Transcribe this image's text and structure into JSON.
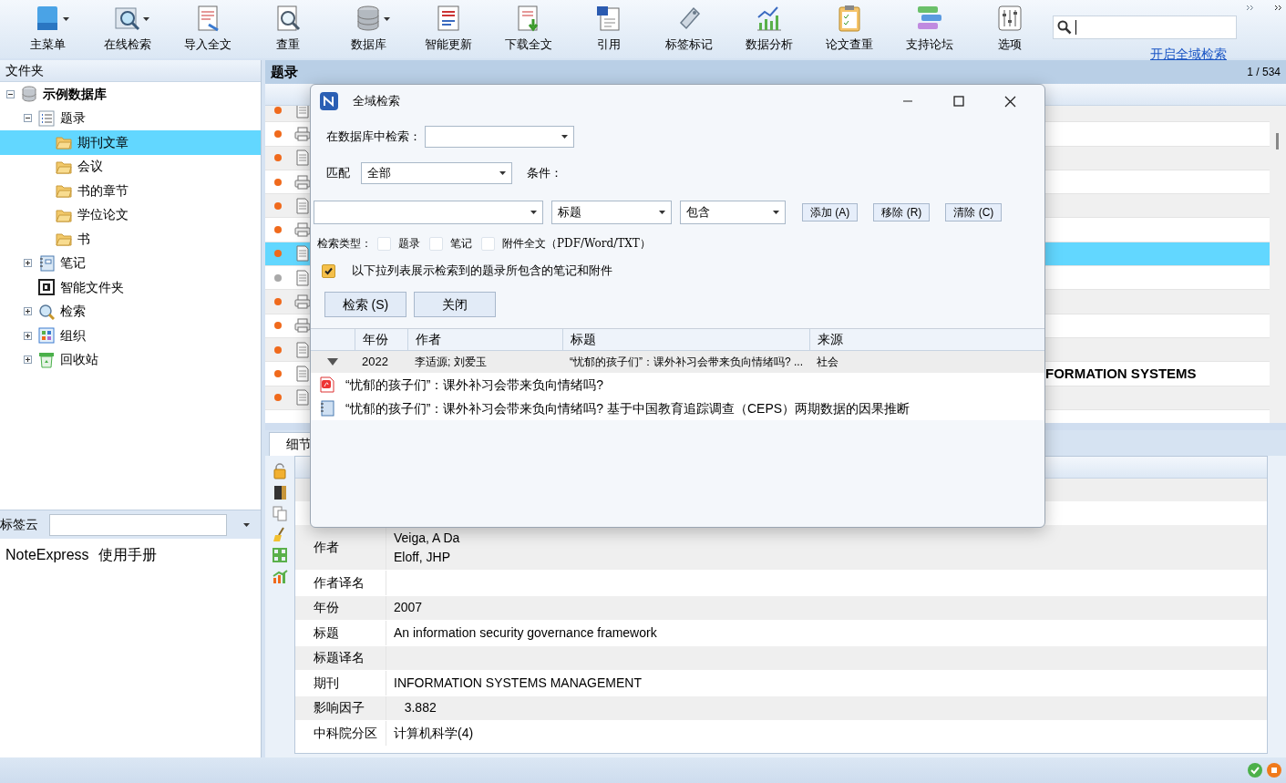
{
  "toolbar": {
    "buttons": [
      {
        "label": "主菜单",
        "dropdown": true
      },
      {
        "label": "在线检索",
        "dropdown": true
      },
      {
        "label": "导入全文",
        "dropdown": false
      },
      {
        "label": "查重",
        "dropdown": false
      },
      {
        "label": "数据库",
        "dropdown": true
      },
      {
        "label": "智能更新",
        "dropdown": false
      },
      {
        "label": "下载全文",
        "dropdown": false
      },
      {
        "label": "引用",
        "dropdown": false
      },
      {
        "label": "标签标记",
        "dropdown": false
      },
      {
        "label": "数据分析",
        "dropdown": false
      },
      {
        "label": "论文查重",
        "dropdown": false
      },
      {
        "label": "支持论坛",
        "dropdown": false
      },
      {
        "label": "选项",
        "dropdown": false
      }
    ],
    "link": "开启全域检索"
  },
  "folder_panel": {
    "title": "文件夹",
    "tree": [
      {
        "label": "示例数据库",
        "kind": "database",
        "expanded": true,
        "selected": false,
        "children": [
          {
            "label": "题录",
            "kind": "list",
            "expanded": true,
            "selected": false,
            "children": [
              {
                "label": "期刊文章",
                "kind": "folder",
                "selected": true
              },
              {
                "label": "会议",
                "kind": "folder",
                "selected": false
              },
              {
                "label": "书的章节",
                "kind": "folder",
                "selected": false
              },
              {
                "label": "学位论文",
                "kind": "folder",
                "selected": false
              },
              {
                "label": "书",
                "kind": "folder",
                "selected": false
              }
            ]
          },
          {
            "label": "笔记",
            "kind": "notebook",
            "expanded": false,
            "selected": false
          },
          {
            "label": "智能文件夹",
            "kind": "smart",
            "selected": false
          },
          {
            "label": "检索",
            "kind": "search",
            "expanded": false,
            "selected": false
          },
          {
            "label": "组织",
            "kind": "organize",
            "expanded": false,
            "selected": false
          },
          {
            "label": "回收站",
            "kind": "recycle",
            "expanded": false,
            "selected": false
          }
        ]
      }
    ]
  },
  "tag_cloud": {
    "label": "标签云",
    "tags": [
      "NoteExpress",
      "使用手册"
    ]
  },
  "records": {
    "title": "题录",
    "counter": "1 / 534",
    "rows": [
      {
        "color": "#f06a1c",
        "kind": "document",
        "selected": false
      },
      {
        "color": "#f06a1c",
        "kind": "printer",
        "selected": false
      },
      {
        "color": "#f06a1c",
        "kind": "document",
        "selected": false
      },
      {
        "color": "#f06a1c",
        "kind": "printer",
        "selected": false
      },
      {
        "color": "#f06a1c",
        "kind": "document",
        "selected": false
      },
      {
        "color": "#f06a1c",
        "kind": "printer",
        "selected": false
      },
      {
        "color": "#f06a1c",
        "kind": "document",
        "selected": true
      },
      {
        "color": "#a9a9a9",
        "kind": "document",
        "selected": false
      },
      {
        "color": "#f06a1c",
        "kind": "printer",
        "selected": false
      },
      {
        "color": "#f06a1c",
        "kind": "printer",
        "selected": false
      },
      {
        "color": "#f06a1c",
        "kind": "document",
        "selected": false
      },
      {
        "color": "#f06a1c",
        "kind": "document",
        "selected": false,
        "text": "FORMATION SYSTEMS"
      },
      {
        "color": "#f06a1c",
        "kind": "document",
        "selected": false
      }
    ]
  },
  "detail": {
    "tabs": [
      {
        "label": "细节",
        "selected": true
      }
    ],
    "fields": [
      {
        "label": "作者",
        "values": [
          "Veiga, A Da",
          "Eloff, JHP"
        ]
      },
      {
        "label": "作者译名"
      },
      {
        "label": "年份",
        "values": [
          "2007"
        ]
      },
      {
        "label": "标题",
        "values": [
          "An information security governance framework"
        ]
      },
      {
        "label": "标题译名"
      },
      {
        "label": "期刊",
        "values": [
          "INFORMATION SYSTEMS MANAGEMENT"
        ]
      },
      {
        "label": "影响因子",
        "values": [
          "   3.882"
        ]
      },
      {
        "label": "中科院分区",
        "values": [
          "计算机科学(4)"
        ]
      }
    ]
  },
  "dialog": {
    "title": "全域检索",
    "database_label": "在数据库中检索：",
    "match_label": "匹配",
    "match_value": "全部",
    "condition_label": "条件：",
    "condition": {
      "field": "标题",
      "operator": "包含"
    },
    "condition_buttons": [
      "添加 (A)",
      "移除 (R)",
      "清除 (C)"
    ],
    "search_type_label": "检索类型：",
    "search_types": [
      {
        "label": "题录",
        "checked": false
      },
      {
        "label": "笔记",
        "checked": false
      },
      {
        "label": "附件全文（PDF/Word/TXT）",
        "checked": false
      }
    ],
    "show_children": {
      "label": "以下拉列表展示检索到的题录所包含的笔记和附件",
      "checked": true
    },
    "actions": [
      "检索 (S)",
      "关闭"
    ],
    "results": {
      "columns": [
        "年份",
        "作者",
        "标题",
        "来源"
      ],
      "groups": [
        {
          "expanded": true,
          "year": "2022",
          "author": "李适源; 刘爱玉",
          "title": "“忧郁的孩子们”：课外补习会带来负向情绪吗? ...",
          "source": "社会",
          "children": [
            {
              "kind": "pdf",
              "title": "“忧郁的孩子们”：课外补习会带来负向情绪吗?"
            },
            {
              "kind": "note",
              "title": "“忧郁的孩子们”：课外补习会带来负向情绪吗?   基于中国教育追踪调查（CEPS）两期数据的因果推断"
            }
          ]
        }
      ]
    }
  }
}
